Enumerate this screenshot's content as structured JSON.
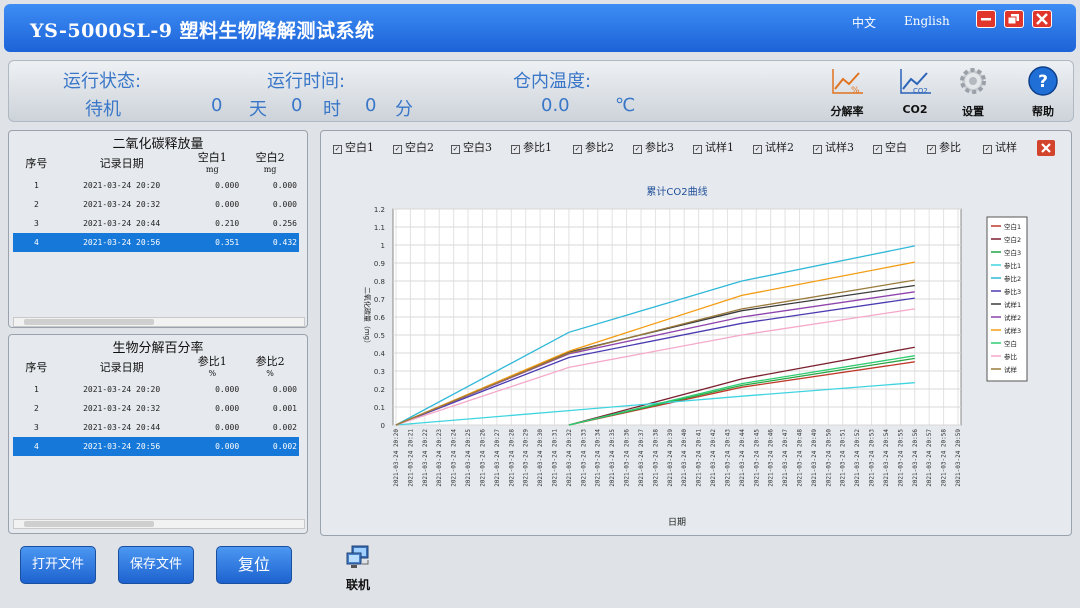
{
  "app": {
    "title": "YS-5000SL-9 塑料生物降解测试系统",
    "lang_zh": "中文",
    "lang_en": "English"
  },
  "status": {
    "run_state_label": "运行状态:",
    "run_state_value": "待机",
    "run_time_label": "运行时间:",
    "days": "0",
    "days_unit": "天",
    "hours": "0",
    "hours_unit": "时",
    "minutes": "0",
    "minutes_unit": "分",
    "temp_label": "仓内温度:",
    "temp_value": "0.0",
    "temp_unit": "℃"
  },
  "toolbar": {
    "degradation": "分解率",
    "co2": "CO2",
    "settings": "设置",
    "help": "帮助",
    "degradation_icon_text": "%",
    "co2_icon_text": "CO2",
    "help_icon_text": "?"
  },
  "co2_table": {
    "title": "二氧化碳释放量",
    "headers": [
      "序号",
      "记录日期",
      "空白1",
      "空白2"
    ],
    "units": [
      "mg",
      "mg"
    ],
    "rows": [
      [
        "1",
        "2021-03-24 20:20",
        "0.000",
        "0.000"
      ],
      [
        "2",
        "2021-03-24 20:32",
        "0.000",
        "0.000"
      ],
      [
        "3",
        "2021-03-24 20:44",
        "0.210",
        "0.256"
      ],
      [
        "4",
        "2021-03-24 20:56",
        "0.351",
        "0.432"
      ]
    ]
  },
  "bio_table": {
    "title": "生物分解百分率",
    "headers": [
      "序号",
      "记录日期",
      "参比1",
      "参比2"
    ],
    "units": [
      "%",
      "%"
    ],
    "rows": [
      [
        "1",
        "2021-03-24 20:20",
        "0.000",
        "0.000"
      ],
      [
        "2",
        "2021-03-24 20:32",
        "0.000",
        "0.001"
      ],
      [
        "3",
        "2021-03-24 20:44",
        "0.000",
        "0.002"
      ],
      [
        "4",
        "2021-03-24 20:56",
        "0.000",
        "0.002"
      ]
    ]
  },
  "checkboxes": [
    "空白1",
    "空白2",
    "空白3",
    "参比1",
    "参比2",
    "参比3",
    "试样1",
    "试样2",
    "试样3",
    "空白",
    "参比",
    "试样"
  ],
  "buttons": {
    "open": "打开文件",
    "save": "保存文件",
    "reset": "复位",
    "online": "联机"
  },
  "chart_data": {
    "type": "line",
    "title": "累计CO2曲线",
    "xlabel": "日期",
    "ylabel": "二氧化碳量（mg）",
    "ylim": [
      0,
      1.2
    ],
    "yticks": [
      "0",
      "0.1",
      "0.2",
      "0.3",
      "0.4",
      "0.5",
      "0.6",
      "0.7",
      "0.8",
      "0.9",
      "1",
      "1.1",
      "1.2"
    ],
    "x": [
      "2021-03-24 20:20",
      "2021-03-24 20:21",
      "2021-03-24 20:22",
      "2021-03-24 20:23",
      "2021-03-24 20:24",
      "2021-03-24 20:25",
      "2021-03-24 20:26",
      "2021-03-24 20:27",
      "2021-03-24 20:28",
      "2021-03-24 20:29",
      "2021-03-24 20:30",
      "2021-03-24 20:31",
      "2021-03-24 20:32",
      "2021-03-24 20:33",
      "2021-03-24 20:34",
      "2021-03-24 20:35",
      "2021-03-24 20:36",
      "2021-03-24 20:37",
      "2021-03-24 20:38",
      "2021-03-24 20:39",
      "2021-03-24 20:40",
      "2021-03-24 20:41",
      "2021-03-24 20:42",
      "2021-03-24 20:43",
      "2021-03-24 20:44",
      "2021-03-24 20:45",
      "2021-03-24 20:46",
      "2021-03-24 20:47",
      "2021-03-24 20:48",
      "2021-03-24 20:49",
      "2021-03-24 20:50",
      "2021-03-24 20:51",
      "2021-03-24 20:52",
      "2021-03-24 20:53",
      "2021-03-24 20:54",
      "2021-03-24 20:55",
      "2021-03-24 20:56",
      "2021-03-24 20:57",
      "2021-03-24 20:58",
      "2021-03-24 20:59"
    ],
    "grid": true,
    "legend": "right",
    "series": [
      {
        "name": "空白1",
        "color": "#c0392b",
        "points": [
          [
            "2021-03-24 20:32",
            0
          ],
          [
            "2021-03-24 20:44",
            0.21
          ],
          [
            "2021-03-24 20:56",
            0.351
          ]
        ]
      },
      {
        "name": "空白2",
        "color": "#7b1f2e",
        "points": [
          [
            "2021-03-24 20:32",
            0
          ],
          [
            "2021-03-24 20:44",
            0.256
          ],
          [
            "2021-03-24 20:56",
            0.432
          ]
        ]
      },
      {
        "name": "空白3",
        "color": "#27a644",
        "points": [
          [
            "2021-03-24 20:32",
            0
          ],
          [
            "2021-03-24 20:44",
            0.22
          ],
          [
            "2021-03-24 20:56",
            0.37
          ]
        ]
      },
      {
        "name": "参比1",
        "color": "#3fd4e0",
        "points": [
          [
            "2021-03-24 20:20",
            0
          ],
          [
            "2021-03-24 20:32",
            0.08
          ],
          [
            "2021-03-24 20:44",
            0.16
          ],
          [
            "2021-03-24 20:56",
            0.235
          ]
        ]
      },
      {
        "name": "参比2",
        "color": "#2fb8d8",
        "points": [
          [
            "2021-03-24 20:20",
            0
          ],
          [
            "2021-03-24 20:32",
            0.515
          ],
          [
            "2021-03-24 20:44",
            0.8
          ],
          [
            "2021-03-24 20:56",
            0.995
          ]
        ]
      },
      {
        "name": "参比3",
        "color": "#4a3bb0",
        "points": [
          [
            "2021-03-24 20:20",
            0
          ],
          [
            "2021-03-24 20:32",
            0.375
          ],
          [
            "2021-03-24 20:44",
            0.565
          ],
          [
            "2021-03-24 20:56",
            0.705
          ]
        ]
      },
      {
        "name": "试样1",
        "color": "#3a3a3a",
        "points": [
          [
            "2021-03-24 20:20",
            0
          ],
          [
            "2021-03-24 20:32",
            0.405
          ],
          [
            "2021-03-24 20:44",
            0.635
          ],
          [
            "2021-03-24 20:56",
            0.775
          ]
        ]
      },
      {
        "name": "试样2",
        "color": "#8e44ad",
        "points": [
          [
            "2021-03-24 20:20",
            0
          ],
          [
            "2021-03-24 20:32",
            0.395
          ],
          [
            "2021-03-24 20:44",
            0.6
          ],
          [
            "2021-03-24 20:56",
            0.74
          ]
        ]
      },
      {
        "name": "试样3",
        "color": "#f39c12",
        "points": [
          [
            "2021-03-24 20:20",
            0
          ],
          [
            "2021-03-24 20:32",
            0.41
          ],
          [
            "2021-03-24 20:44",
            0.72
          ],
          [
            "2021-03-24 20:56",
            0.905
          ]
        ]
      },
      {
        "name": "空白",
        "color": "#2ecc71",
        "points": [
          [
            "2021-03-24 20:32",
            0
          ],
          [
            "2021-03-24 20:44",
            0.23
          ],
          [
            "2021-03-24 20:56",
            0.385
          ]
        ]
      },
      {
        "name": "参比",
        "color": "#f5a9c9",
        "points": [
          [
            "2021-03-24 20:20",
            0
          ],
          [
            "2021-03-24 20:32",
            0.32
          ],
          [
            "2021-03-24 20:44",
            0.5
          ],
          [
            "2021-03-24 20:56",
            0.645
          ]
        ]
      },
      {
        "name": "试样",
        "color": "#9a7a3c",
        "points": [
          [
            "2021-03-24 20:20",
            0
          ],
          [
            "2021-03-24 20:32",
            0.4
          ],
          [
            "2021-03-24 20:44",
            0.645
          ],
          [
            "2021-03-24 20:56",
            0.805
          ]
        ]
      }
    ]
  }
}
